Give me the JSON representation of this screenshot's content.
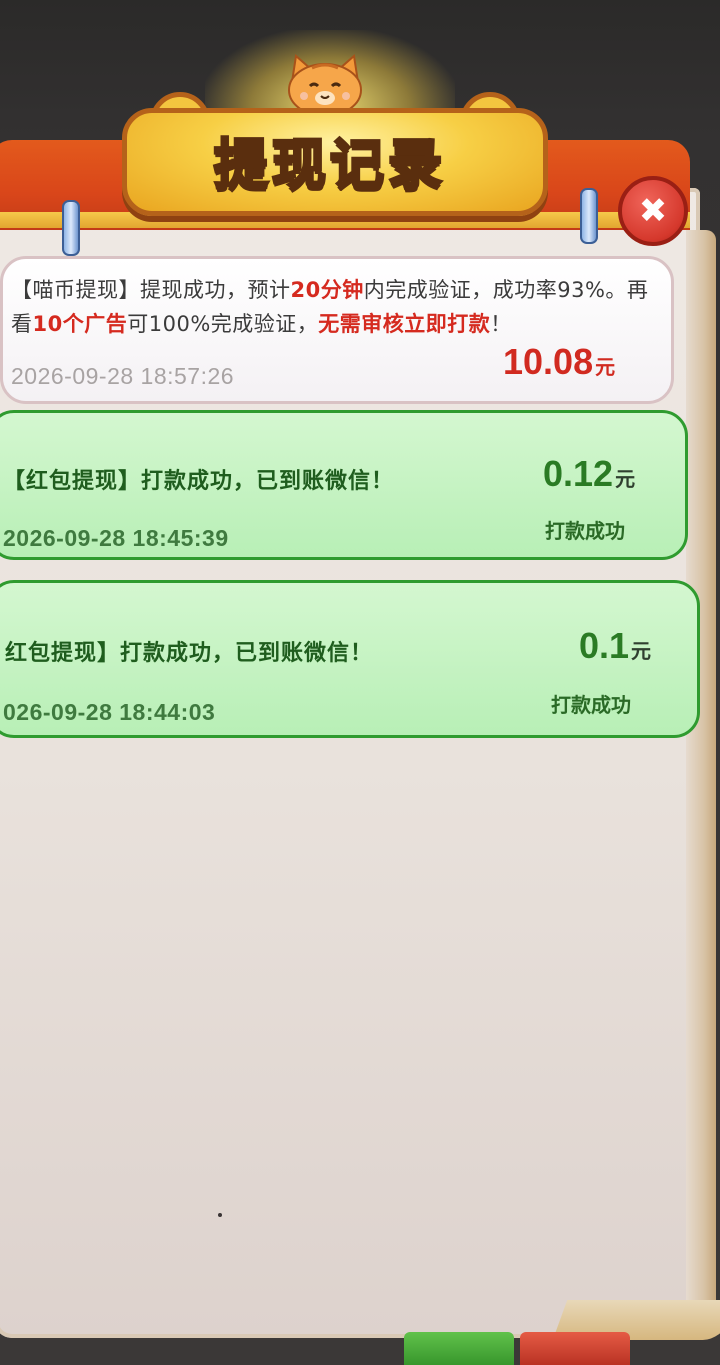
{
  "dialog": {
    "title": "提现记录",
    "close_symbol": "✖"
  },
  "records": [
    {
      "type": "pending",
      "message_parts": [
        {
          "text": "【喵币提现】提现成功，预计",
          "color": "normal"
        },
        {
          "text": "20分钟",
          "color": "red"
        },
        {
          "text": "内完成验证，成功率93%。再看",
          "color": "normal"
        },
        {
          "text": "10个广告",
          "color": "red"
        },
        {
          "text": "可100%完成验证，",
          "color": "normal"
        },
        {
          "text": "无需审核立即打款",
          "color": "red"
        },
        {
          "text": "！",
          "color": "normal"
        }
      ],
      "timestamp": "2026-09-28 18:57:26",
      "amount": "10.08",
      "unit": "元"
    },
    {
      "type": "success",
      "message": "【红包提现】打款成功，已到账微信！",
      "timestamp": "2026-09-28 18:45:39",
      "amount": "0.12",
      "unit": "元",
      "status": "打款成功"
    },
    {
      "type": "success",
      "message": "红包提现】打款成功，已到账微信！",
      "timestamp": "026-09-28 18:44:03",
      "amount": "0.1",
      "unit": "元",
      "status": "打款成功"
    }
  ],
  "colors": {
    "accent_red": "#d12a20",
    "accent_green": "#2a7b24",
    "header_orange": "#d9461a"
  }
}
